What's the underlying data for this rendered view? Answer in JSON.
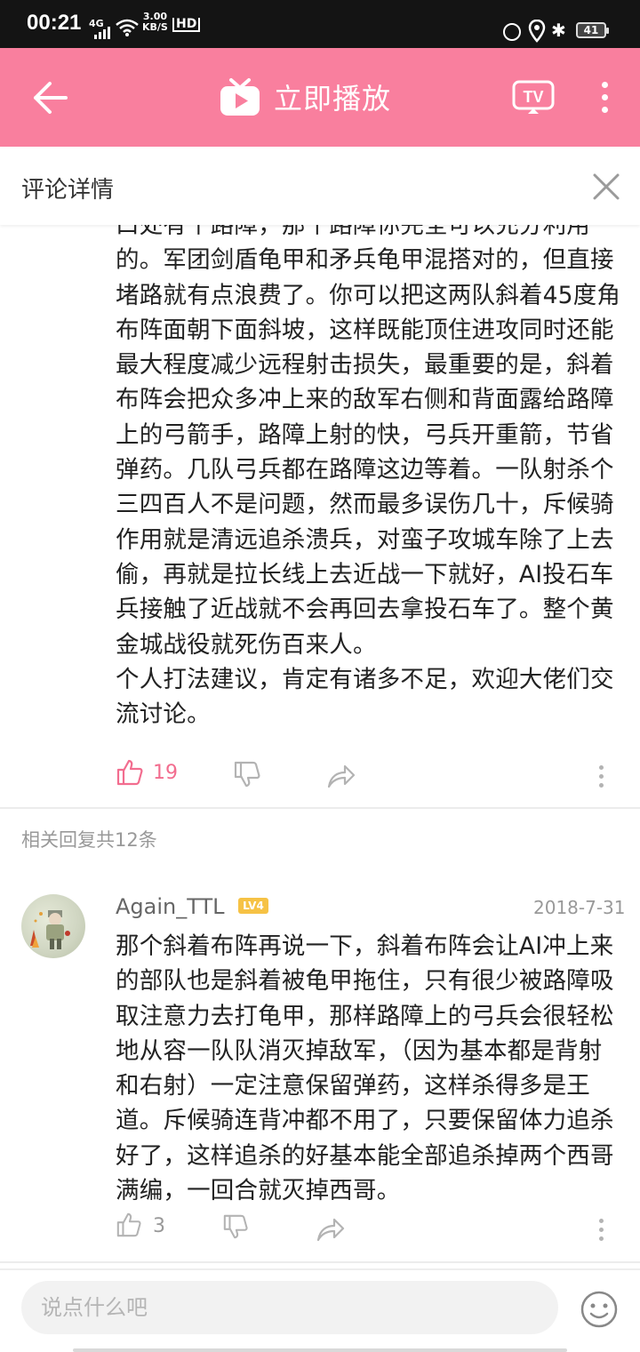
{
  "status_bar": {
    "time": "00:21",
    "network": "4G",
    "speed_value": "3.00",
    "speed_unit": "KB/S",
    "hd": "HD",
    "battery": "41"
  },
  "app_bar": {
    "title": "立即播放",
    "bg_color": "#f97f9e",
    "icons": [
      "back-arrow-icon",
      "tv-logo-icon",
      "cast-tv-icon",
      "more-vertical-icon"
    ],
    "cast_label": "TV"
  },
  "sheet": {
    "title": "评论详情"
  },
  "main_comment": {
    "text": "口处有个路障，那个路障你完全可以充分利用的。军团剑盾龟甲和矛兵龟甲混搭对的，但直接堵路就有点浪费了。你可以把这两队斜着45度角布阵面朝下面斜坡，这样既能顶住进攻同时还能最大程度减少远程射击损失，最重要的是，斜着布阵会把众多冲上来的敌军右侧和背面露给路障上的弓箭手，路障上射的快，弓兵开重箭，节省弹药。几队弓兵都在路障这边等着。一队射杀个三四百人不是问题，然而最多误伤几十，斥候骑作用就是清远追杀溃兵，对蛮子攻城车除了上去偷，再就是拉长线上去近战一下就好，AI投石车兵接触了近战就不会再回去拿投石车了。整个黄金城战役就死伤百来人。\n个人打法建议，肯定有诸多不足，欢迎大佬们交流讨论。",
    "likes": "19",
    "like_color": "#f26d8f"
  },
  "replies_section": {
    "label": "相关回复共12条"
  },
  "reply": {
    "username": "Again_TTL",
    "level": "LV4",
    "date": "2018-7-31",
    "text": "那个斜着布阵再说一下，斜着布阵会让AI冲上来的部队也是斜着被龟甲拖住，只有很少被路障吸取注意力去打龟甲，那样路障上的弓兵会很轻松地从容一队队消灭掉敌军，（因为基本都是背射和右射）一定注意保留弹药，这样杀得多是王道。斥候骑连背冲都不用了，只要保留体力追杀好了，这样追杀的好基本能全部追杀掉两个西哥满编，一回合就灭掉西哥。",
    "likes": "3"
  },
  "bottom_bar": {
    "placeholder": "说点什么吧",
    "value": ""
  }
}
